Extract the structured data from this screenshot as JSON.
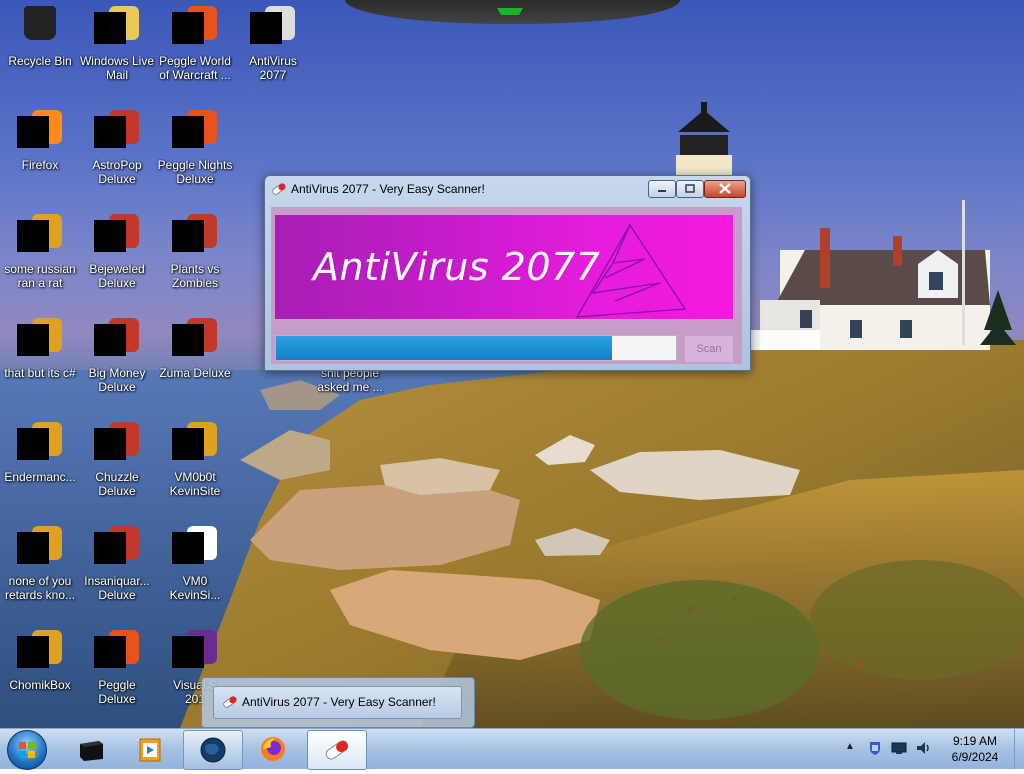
{
  "desktop": {
    "icons": [
      {
        "label": "Recycle Bin",
        "col": 0,
        "row": 0,
        "kind": "recycle-bin-icon"
      },
      {
        "label": "Windows Live\nMail",
        "col": 1,
        "row": 0,
        "kind": "mail-icon"
      },
      {
        "label": "Peggle World\nof Warcraft ...",
        "col": 2,
        "row": 0,
        "kind": "peggle-icon"
      },
      {
        "label": "AntiVirus\n2077",
        "col": 3,
        "row": 0,
        "kind": "antivirus-icon"
      },
      {
        "label": "Firefox",
        "col": 0,
        "row": 1,
        "kind": "firefox-icon"
      },
      {
        "label": "AstroPop\nDeluxe",
        "col": 1,
        "row": 1,
        "kind": "game-icon"
      },
      {
        "label": "Peggle Nights\nDeluxe",
        "col": 2,
        "row": 1,
        "kind": "peggle-icon"
      },
      {
        "label": "some russian\nran a rat",
        "col": 0,
        "row": 2,
        "kind": "program-icon"
      },
      {
        "label": "Bejeweled\nDeluxe",
        "col": 1,
        "row": 2,
        "kind": "game-icon"
      },
      {
        "label": "Plants vs\nZombies",
        "col": 2,
        "row": 2,
        "kind": "game-icon"
      },
      {
        "label": "that but its c#",
        "col": 0,
        "row": 3,
        "kind": "program-icon"
      },
      {
        "label": "Big Money\nDeluxe",
        "col": 1,
        "row": 3,
        "kind": "game-icon"
      },
      {
        "label": "Zuma Deluxe",
        "col": 2,
        "row": 3,
        "kind": "game-icon"
      },
      {
        "label": "shit people\nasked me ...",
        "col": 4,
        "row": 3,
        "kind": "file-icon"
      },
      {
        "label": "Endermanc...",
        "col": 0,
        "row": 4,
        "kind": "program-icon"
      },
      {
        "label": "Chuzzle\nDeluxe",
        "col": 1,
        "row": 4,
        "kind": "game-icon"
      },
      {
        "label": "VM0b0t\nKevinSite",
        "col": 2,
        "row": 4,
        "kind": "program-icon"
      },
      {
        "label": "none of you\nretards kno...",
        "col": 0,
        "row": 5,
        "kind": "program-icon"
      },
      {
        "label": "Insaniquar...\nDeluxe",
        "col": 1,
        "row": 5,
        "kind": "game-icon"
      },
      {
        "label": "VM0\nKevinSi...",
        "col": 2,
        "row": 5,
        "kind": "file-icon"
      },
      {
        "label": "ChomikBox",
        "col": 0,
        "row": 6,
        "kind": "program-icon"
      },
      {
        "label": "Peggle Deluxe",
        "col": 1,
        "row": 6,
        "kind": "peggle-icon"
      },
      {
        "label": "Visual S\n201",
        "col": 2,
        "row": 6,
        "kind": "visual-studio-icon"
      }
    ]
  },
  "window": {
    "title": "AntiVirus 2077 - Very Easy Scanner!",
    "banner_text": "AntiVirus 2077",
    "progress": 0.84,
    "scan_label": "Scan",
    "scan_enabled": false
  },
  "thumbnail": {
    "title": "AntiVirus 2077 - Very Easy Scanner!"
  },
  "taskbar": {
    "buttons": [
      {
        "name": "taskbar-terminal-app",
        "state": "pinned",
        "kind": "terminal-icon"
      },
      {
        "name": "taskbar-media-app",
        "state": "pinned",
        "kind": "media-player-icon"
      },
      {
        "name": "taskbar-globe-app",
        "state": "open",
        "kind": "globe-icon"
      },
      {
        "name": "taskbar-firefox",
        "state": "pinned",
        "kind": "firefox-icon"
      },
      {
        "name": "taskbar-antivirus",
        "state": "active",
        "kind": "pill-icon"
      }
    ],
    "clock": {
      "time": "9:19 AM",
      "date": "6/9/2024"
    }
  },
  "colors": {
    "banner_start": "#a61fb3",
    "banner_end": "#f519dd",
    "progress_fill": "#1a8fd6",
    "client_bg": "#c79cc9"
  }
}
